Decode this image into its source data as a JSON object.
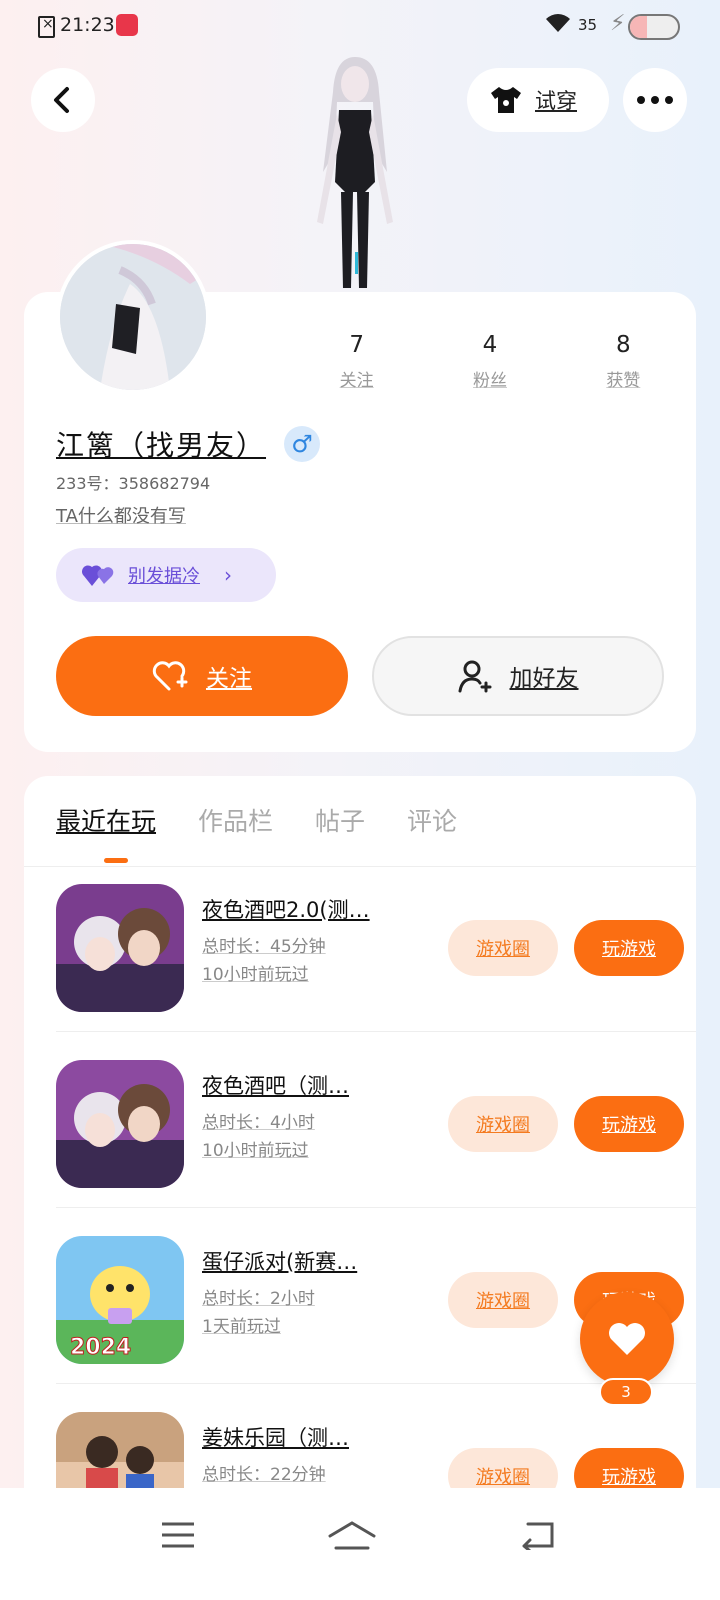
{
  "status_bar": {
    "time": "21:23",
    "battery": "35",
    "battery_level": 0.35
  },
  "header": {
    "dress_label": "试穿"
  },
  "profile": {
    "stats": [
      {
        "value": "7",
        "label": "关注"
      },
      {
        "value": "4",
        "label": "粉丝"
      },
      {
        "value": "8",
        "label": "获赞"
      }
    ],
    "name": "江篱（找男友）",
    "gender_symbol": "♂",
    "uid": "233号：358682794",
    "bio": "TA什么都没有写",
    "pill_label": "别发据冷",
    "follow_label": "关注",
    "add_friend_label": "加好友"
  },
  "tabs": [
    "最近在玩",
    "作品栏",
    "帖子",
    "评论"
  ],
  "games": [
    {
      "name": "夜色酒吧2.0(测…",
      "duration": "总时长：45分钟",
      "last_played": "10小时前玩过",
      "circle_label": "游戏圈",
      "play_label": "玩游戏"
    },
    {
      "name": "夜色酒吧（测…",
      "duration": "总时长：4小时",
      "last_played": "10小时前玩过",
      "circle_label": "游戏圈",
      "play_label": "玩游戏"
    },
    {
      "name": "蛋仔派对(新赛…",
      "duration": "总时长：2小时",
      "last_played": "1天前玩过",
      "circle_label": "游戏圈",
      "play_label": "玩游戏"
    },
    {
      "name": "姜妹乐园（测…",
      "duration": "总时长：22分钟",
      "last_played": "",
      "circle_label": "游戏圈",
      "play_label": "玩游戏"
    }
  ],
  "fab": {
    "badge": "3"
  },
  "colors": {
    "accent": "#fb6e12",
    "accent_light": "#fde7d9",
    "pill_bg": "#ebe6fb",
    "pill_text": "#6a4fd8"
  }
}
